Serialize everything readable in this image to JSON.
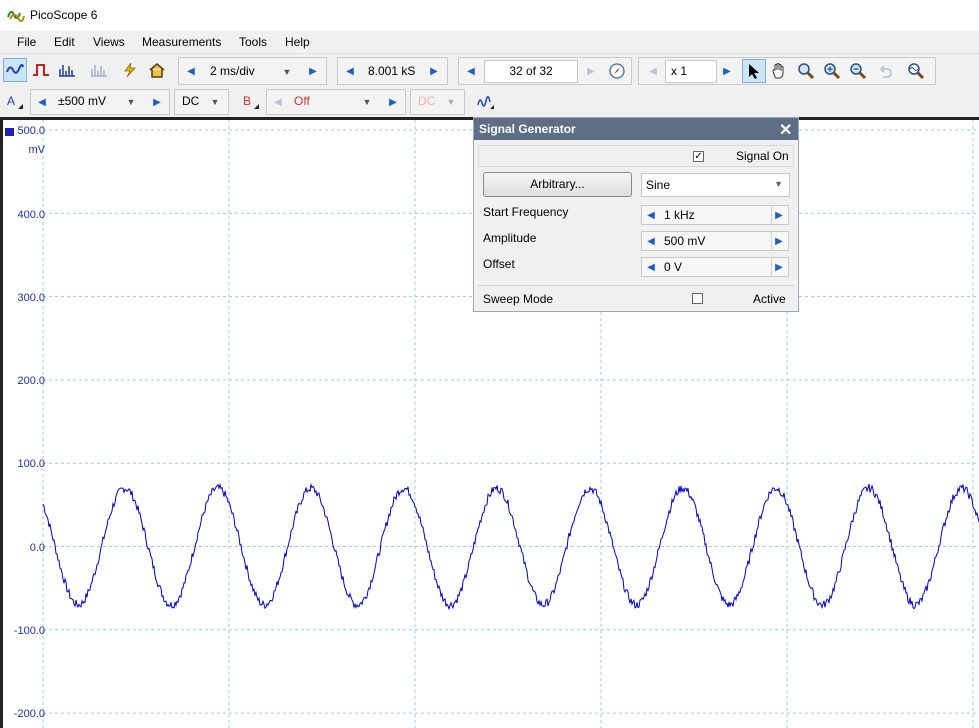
{
  "window": {
    "title": "PicoScope 6"
  },
  "menu": [
    "File",
    "Edit",
    "Views",
    "Measurements",
    "Tools",
    "Help"
  ],
  "toolbar": {
    "timebase": "2 ms/div",
    "samples": "8.001 kS",
    "buffer": "32 of 32",
    "zoom": "x 1"
  },
  "channels": {
    "a": {
      "label": "A",
      "range": "±500 mV",
      "coupling": "DC"
    },
    "b": {
      "label": "B",
      "range": "Off",
      "coupling": "DC"
    }
  },
  "scope": {
    "unit": "mV",
    "y_ticks": [
      "500.0",
      "400.0",
      "300.0",
      "200.0",
      "100.0",
      "0.0",
      "-100.0",
      "-200.0"
    ],
    "trace_color": "#0000cc",
    "grid_color": "#9ec9e6"
  },
  "signal_generator": {
    "title": "Signal Generator",
    "signal_on_label": "Signal On",
    "signal_on": true,
    "arbitrary_label": "Arbitrary...",
    "waveform": "Sine",
    "start_frequency_label": "Start Frequency",
    "start_frequency": "1 kHz",
    "amplitude_label": "Amplitude",
    "amplitude": "500 mV",
    "offset_label": "Offset",
    "offset": "0 V",
    "sweep_mode_label": "Sweep Mode",
    "sweep_active_label": "Active",
    "sweep_active": false
  },
  "chart_data": {
    "type": "line",
    "ylabel": "mV",
    "ylim": [
      -200,
      500
    ],
    "series": [
      {
        "waveform": "sine",
        "frequency_hz": 1000,
        "amplitude_mv": 70,
        "offset_mv": 0,
        "cycles_visible": 10
      }
    ]
  }
}
